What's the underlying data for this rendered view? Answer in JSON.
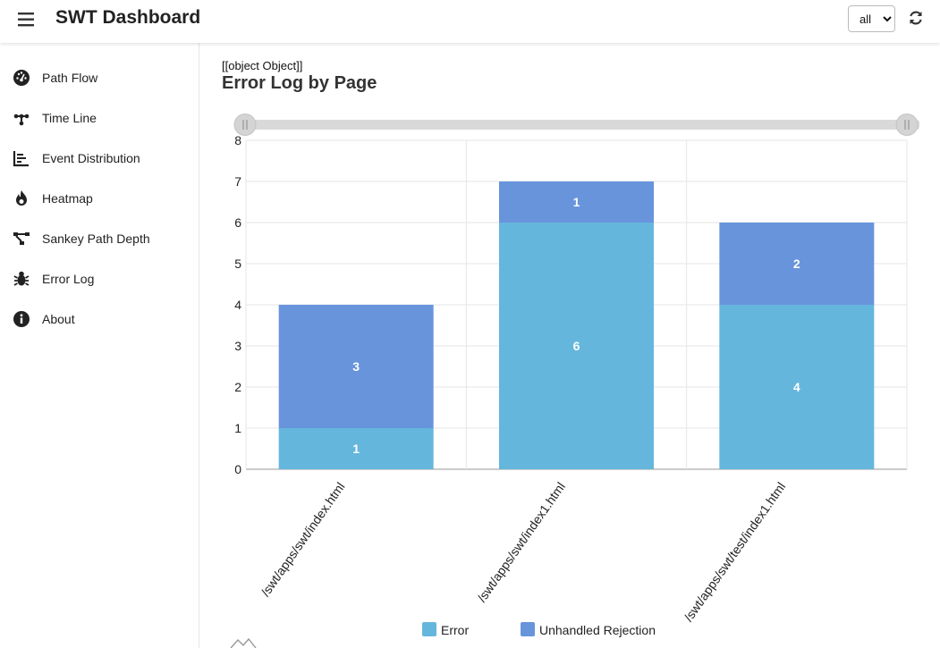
{
  "header": {
    "title": "SWT Dashboard",
    "filter": {
      "selected": "all",
      "options": [
        "all"
      ]
    },
    "menu_icon": "hamburger-icon",
    "refresh_icon": "refresh-icon"
  },
  "sidebar": {
    "items": [
      {
        "label": "Path Flow",
        "icon": "dashboard-gauge-icon"
      },
      {
        "label": "Time Line",
        "icon": "timeline-icon"
      },
      {
        "label": "Event Distribution",
        "icon": "bar-chart-icon"
      },
      {
        "label": "Heatmap",
        "icon": "fire-icon"
      },
      {
        "label": "Sankey Path Depth",
        "icon": "sankey-icon"
      },
      {
        "label": "Error Log",
        "icon": "bug-icon"
      },
      {
        "label": "About",
        "icon": "info-icon"
      }
    ]
  },
  "main": {
    "raw_label": "[[object Object]]",
    "title": "Error Log by Page"
  },
  "chart_data": {
    "type": "bar",
    "stacked": true,
    "categories": [
      "/swt/apps/swt/index.html",
      "/swt/apps/swt/index1.html",
      "/swt/apps/swt/test/index1.html"
    ],
    "series": [
      {
        "name": "Error",
        "values": [
          1,
          6,
          4
        ],
        "color": "#65b6dc"
      },
      {
        "name": "Unhandled Rejection",
        "values": [
          3,
          1,
          2
        ],
        "color": "#6894dc"
      }
    ],
    "ylim": [
      0,
      8
    ],
    "yticks": [
      0,
      1,
      2,
      3,
      4,
      5,
      6,
      7,
      8
    ],
    "grid": true,
    "legend_position": "bottom",
    "data_zoom_slider": {
      "start": 0,
      "end": 100
    }
  }
}
